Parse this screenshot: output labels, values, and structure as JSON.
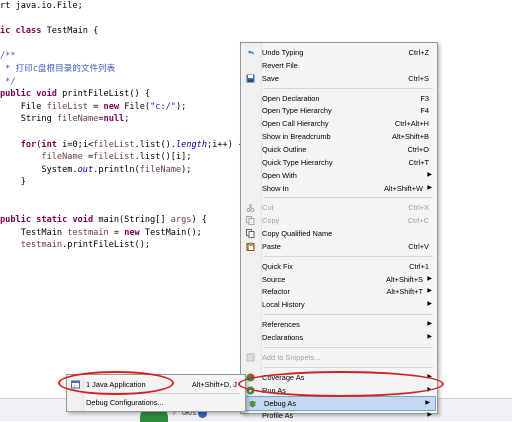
{
  "code_lines": [
    {
      "segments": [
        {
          "t": "rt java.io.File;",
          "c": "var"
        }
      ]
    },
    {
      "segments": [
        {
          "t": "",
          "c": "var"
        }
      ]
    },
    {
      "segments": [
        {
          "t": "ic ",
          "c": "kw"
        },
        {
          "t": "class ",
          "c": "kw"
        },
        {
          "t": "TestMain {",
          "c": "var"
        }
      ]
    },
    {
      "segments": [
        {
          "t": "",
          "c": "var"
        }
      ]
    },
    {
      "segments": [
        {
          "t": "/**",
          "c": "jd"
        }
      ]
    },
    {
      "segments": [
        {
          "t": " * 打印c盘根目录的文件列表",
          "c": "jd"
        }
      ]
    },
    {
      "segments": [
        {
          "t": " */",
          "c": "jd"
        }
      ]
    },
    {
      "segments": [
        {
          "t": "public ",
          "c": "kw"
        },
        {
          "t": "void ",
          "c": "kw"
        },
        {
          "t": "printFileList() {",
          "c": "var"
        }
      ]
    },
    {
      "segments": [
        {
          "t": "    File ",
          "c": "var"
        },
        {
          "t": "fileList",
          "c": "loc"
        },
        {
          "t": " = ",
          "c": "var"
        },
        {
          "t": "new ",
          "c": "kw"
        },
        {
          "t": "File(",
          "c": "var"
        },
        {
          "t": "\"c:/\"",
          "c": "str"
        },
        {
          "t": ");",
          "c": "var"
        }
      ]
    },
    {
      "segments": [
        {
          "t": "    String ",
          "c": "var"
        },
        {
          "t": "fileName",
          "c": "loc"
        },
        {
          "t": "=",
          "c": "var"
        },
        {
          "t": "null",
          "c": "kw"
        },
        {
          "t": ";",
          "c": "var"
        }
      ]
    },
    {
      "segments": [
        {
          "t": "",
          "c": "var"
        }
      ]
    },
    {
      "segments": [
        {
          "t": "    ",
          "c": "var"
        },
        {
          "t": "for",
          "c": "kw"
        },
        {
          "t": "(",
          "c": "var"
        },
        {
          "t": "int ",
          "c": "kw"
        },
        {
          "t": "i=0;i<",
          "c": "var"
        },
        {
          "t": "fileList",
          "c": "loc"
        },
        {
          "t": ".list().",
          "c": "var"
        },
        {
          "t": "length",
          "c": "fld"
        },
        {
          "t": ";i++) {",
          "c": "var"
        }
      ]
    },
    {
      "segments": [
        {
          "t": "        ",
          "c": "var"
        },
        {
          "t": "fileName",
          "c": "loc"
        },
        {
          "t": " =",
          "c": "var"
        },
        {
          "t": "fileList",
          "c": "loc"
        },
        {
          "t": ".list()[i];",
          "c": "var"
        }
      ]
    },
    {
      "segments": [
        {
          "t": "        System.",
          "c": "var"
        },
        {
          "t": "out",
          "c": "fld"
        },
        {
          "t": ".println(",
          "c": "var"
        },
        {
          "t": "fileName",
          "c": "loc"
        },
        {
          "t": ");",
          "c": "var"
        }
      ]
    },
    {
      "segments": [
        {
          "t": "    }",
          "c": "var"
        }
      ]
    },
    {
      "segments": [
        {
          "t": "",
          "c": "var"
        }
      ]
    },
    {
      "segments": [
        {
          "t": "",
          "c": "var"
        }
      ]
    },
    {
      "segments": [
        {
          "t": "public ",
          "c": "kw"
        },
        {
          "t": "static ",
          "c": "kw"
        },
        {
          "t": "void ",
          "c": "kw"
        },
        {
          "t": "main(String[] ",
          "c": "var"
        },
        {
          "t": "args",
          "c": "loc"
        },
        {
          "t": ") {",
          "c": "var"
        }
      ]
    },
    {
      "segments": [
        {
          "t": "    TestMain ",
          "c": "var"
        },
        {
          "t": "testmain",
          "c": "loc"
        },
        {
          "t": " = ",
          "c": "var"
        },
        {
          "t": "new ",
          "c": "kw"
        },
        {
          "t": "TestMain();",
          "c": "var"
        }
      ]
    },
    {
      "segments": [
        {
          "t": "    ",
          "c": "var"
        },
        {
          "t": "testmain",
          "c": "loc"
        },
        {
          "t": ".printFileList();",
          "c": "var"
        }
      ]
    },
    {
      "segments": [
        {
          "t": "",
          "c": "var"
        }
      ]
    }
  ],
  "context_menu": {
    "items": [
      {
        "label": "Undo Typing",
        "shortcut": "Ctrl+Z",
        "icon": "undo-icon",
        "disabled": false,
        "submenu": false
      },
      {
        "label": "Revert File",
        "shortcut": "",
        "icon": "",
        "disabled": false,
        "submenu": false
      },
      {
        "label": "Save",
        "shortcut": "Ctrl+S",
        "icon": "save-icon",
        "disabled": false,
        "submenu": false
      },
      {
        "sep": true
      },
      {
        "label": "Open Declaration",
        "shortcut": "F3",
        "icon": "",
        "disabled": false,
        "submenu": false
      },
      {
        "label": "Open Type Hierarchy",
        "shortcut": "F4",
        "icon": "",
        "disabled": false,
        "submenu": false
      },
      {
        "label": "Open Call Hierarchy",
        "shortcut": "Ctrl+Alt+H",
        "icon": "",
        "disabled": false,
        "submenu": false
      },
      {
        "label": "Show in Breadcrumb",
        "shortcut": "Alt+Shift+B",
        "icon": "",
        "disabled": false,
        "submenu": false
      },
      {
        "label": "Quick Outline",
        "shortcut": "Ctrl+O",
        "icon": "",
        "disabled": false,
        "submenu": false
      },
      {
        "label": "Quick Type Hierarchy",
        "shortcut": "Ctrl+T",
        "icon": "",
        "disabled": false,
        "submenu": false
      },
      {
        "label": "Open With",
        "shortcut": "",
        "icon": "",
        "disabled": false,
        "submenu": true
      },
      {
        "label": "Show In",
        "shortcut": "Alt+Shift+W",
        "icon": "",
        "disabled": false,
        "submenu": true
      },
      {
        "sep": true
      },
      {
        "label": "Cut",
        "shortcut": "Ctrl+X",
        "icon": "cut-icon",
        "disabled": true,
        "submenu": false
      },
      {
        "label": "Copy",
        "shortcut": "Ctrl+C",
        "icon": "copy-icon",
        "disabled": true,
        "submenu": false
      },
      {
        "label": "Copy Qualified Name",
        "shortcut": "",
        "icon": "copy-qualified-icon",
        "disabled": false,
        "submenu": false
      },
      {
        "label": "Paste",
        "shortcut": "Ctrl+V",
        "icon": "paste-icon",
        "disabled": false,
        "submenu": false
      },
      {
        "sep": true
      },
      {
        "label": "Quick Fix",
        "shortcut": "Ctrl+1",
        "icon": "",
        "disabled": false,
        "submenu": false
      },
      {
        "label": "Source",
        "shortcut": "Alt+Shift+S",
        "icon": "",
        "disabled": false,
        "submenu": true
      },
      {
        "label": "Refactor",
        "shortcut": "Alt+Shift+T",
        "icon": "",
        "disabled": false,
        "submenu": true
      },
      {
        "label": "Local History",
        "shortcut": "",
        "icon": "",
        "disabled": false,
        "submenu": true
      },
      {
        "sep": true
      },
      {
        "label": "References",
        "shortcut": "",
        "icon": "",
        "disabled": false,
        "submenu": true
      },
      {
        "label": "Declarations",
        "shortcut": "",
        "icon": "",
        "disabled": false,
        "submenu": true
      },
      {
        "sep": true
      },
      {
        "label": "Add to Snippets...",
        "shortcut": "",
        "icon": "snippet-icon",
        "disabled": true,
        "submenu": false
      },
      {
        "sep": true
      },
      {
        "label": "Coverage As",
        "shortcut": "",
        "icon": "coverage-icon",
        "disabled": false,
        "submenu": true
      },
      {
        "label": "Run As",
        "shortcut": "",
        "icon": "run-icon",
        "disabled": false,
        "submenu": true
      },
      {
        "label": "Debug As",
        "shortcut": "",
        "icon": "debug-icon",
        "disabled": false,
        "submenu": true,
        "highlight": true
      },
      {
        "label": "Profile As",
        "shortcut": "",
        "icon": "",
        "disabled": false,
        "submenu": true
      }
    ]
  },
  "submenu": {
    "items": [
      {
        "label": "1 Java Application",
        "shortcut": "Alt+Shift+D, J",
        "icon": "java-app-icon"
      },
      {
        "label": "Debug Configurations...",
        "shortcut": "",
        "icon": ""
      }
    ]
  },
  "taskbar": {
    "badge": "11%",
    "items": [
      "?",
      "0K/s"
    ]
  },
  "colors": {
    "keyword": "#7f0055",
    "string": "#2a00ff",
    "javadoc": "#3f5fbf",
    "highlight": "#c3d9f1",
    "annotation": "#d42020"
  }
}
